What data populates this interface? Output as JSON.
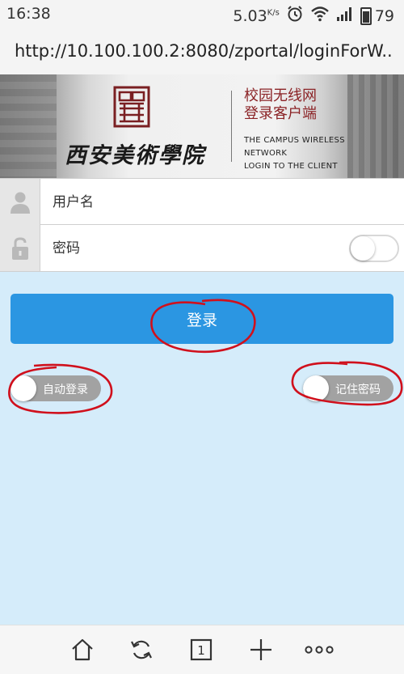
{
  "status_bar": {
    "time": "16:38",
    "speed": "5.03",
    "speed_unit": "K/s",
    "battery": "79"
  },
  "browser": {
    "url": "http://10.100.100.2:8080/zportal/loginForW.."
  },
  "banner": {
    "school_name": "西安美術學院",
    "cn_title_line1": "校园无线网",
    "cn_title_line2": "登录客户端",
    "en_title_line1": "THE CAMPUS WIRELESS",
    "en_title_line2": "NETWORK",
    "en_title_line3": "LOGIN TO THE CLIENT"
  },
  "form": {
    "username_placeholder": "用户名",
    "password_placeholder": "密码",
    "login_label": "登录",
    "auto_login_label": "自动登录",
    "remember_password_label": "记住密码",
    "auto_login_on": false,
    "remember_password_on": false,
    "show_password_on": false
  },
  "icons": {
    "user": "user-icon",
    "lock": "lock-icon",
    "home": "home-icon",
    "refresh": "refresh-icon",
    "tabs": "tabs-icon",
    "new_tab": "plus-icon",
    "more": "more-icon"
  },
  "bottom_bar": {
    "tab_count": "1"
  },
  "colors": {
    "accent": "#2b96e2",
    "page_bg": "#d5ecfa",
    "annotation": "#d0101c"
  }
}
